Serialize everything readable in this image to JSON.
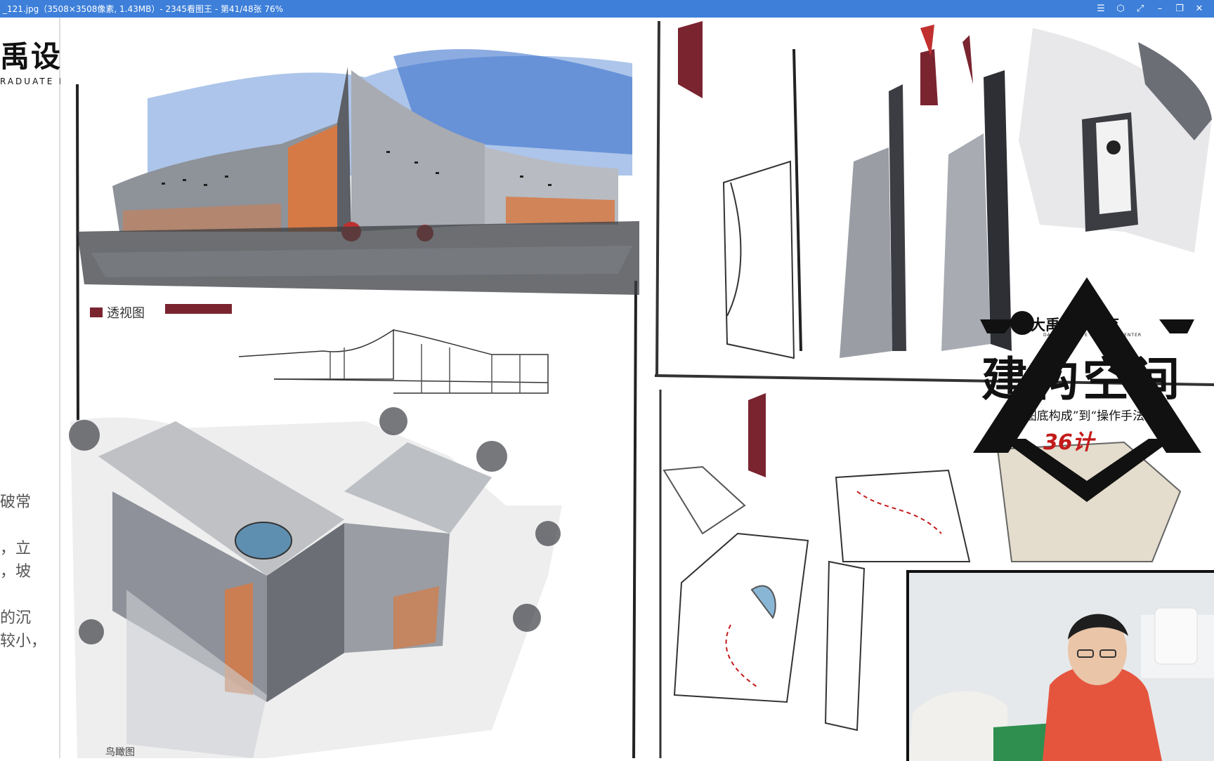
{
  "window": {
    "title": "_121.jpg（3508×3508像素, 1.43MB）- 2345看图王 - 第41/48张 76%",
    "controls": [
      "menu-icon",
      "skin-icon",
      "fullscreen-icon",
      "minimize-icon",
      "restore-icon",
      "close-icon"
    ]
  },
  "left_panel": {
    "logo_main": "禹设计教育",
    "logo_sub": "RADUATE RESEARCH CENTER",
    "side_text": [
      "破常",
      "，立",
      "，坡",
      "的沉",
      "较小，"
    ]
  },
  "sheet_left": {
    "label_perspective": "透视图",
    "label_axon": "鸟瞰图"
  },
  "badge": {
    "brand": "大禹设计教育",
    "brand_sub": "DAYU GRADUATE RESEARCH CENTER",
    "title": "建构空间",
    "subtitle": "从“图底构成”到“操作手法”",
    "red_mark": "36计"
  },
  "colors": {
    "titlebar": "#3d7fd9",
    "sky_blue": "#4a7fd0",
    "orange": "#d57a45",
    "maroon": "#7a2430",
    "badge_red": "#c41a1a"
  }
}
